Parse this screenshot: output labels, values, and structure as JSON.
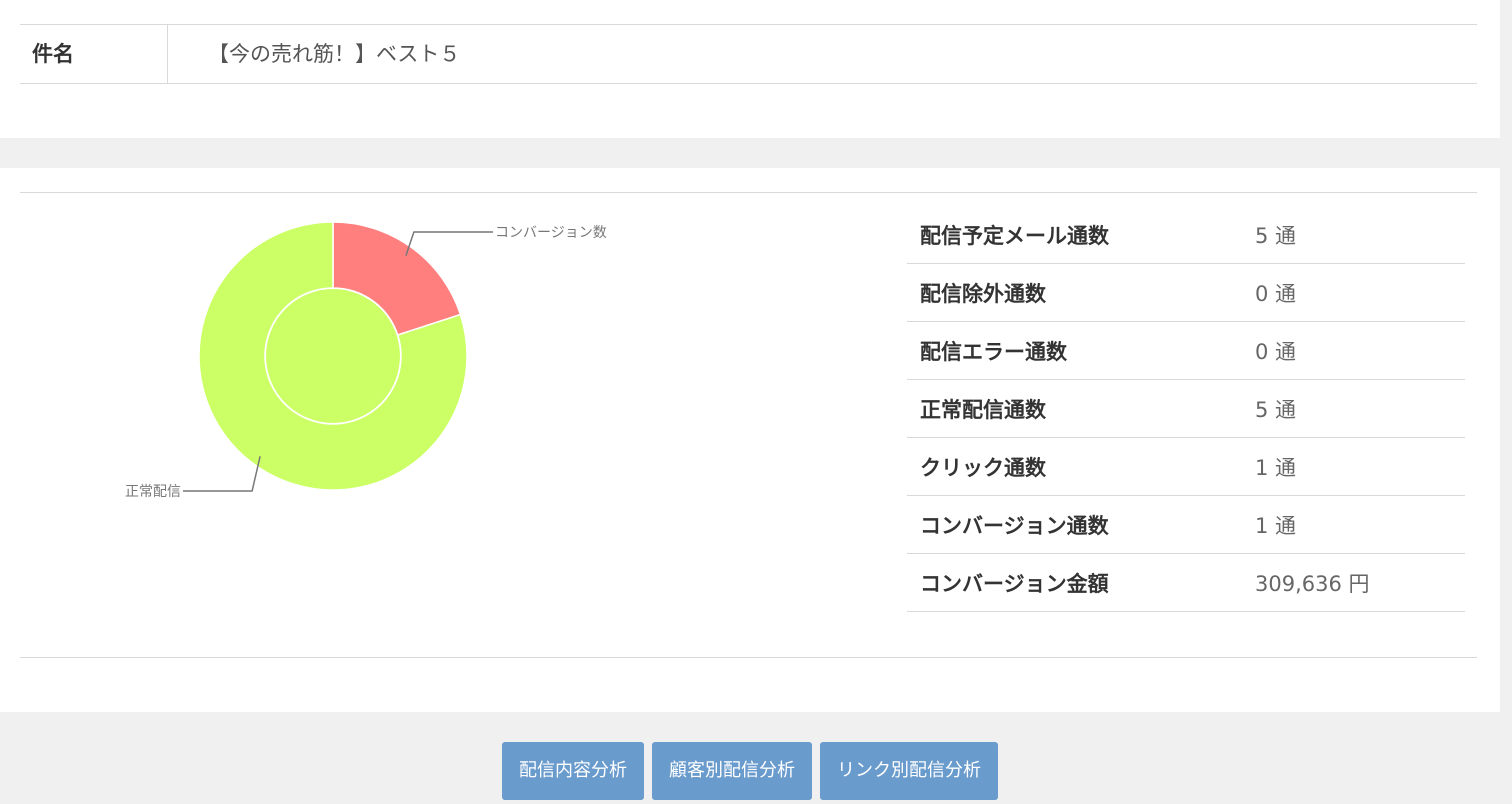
{
  "subject": {
    "label": "件名",
    "value": "【今の売れ筋！】ベスト５"
  },
  "chart_data": {
    "type": "pie",
    "variant": "two-ring-donut",
    "slices": [
      {
        "label": "コンバージョン数",
        "value": 1,
        "color": "#ff7f7f"
      },
      {
        "label": "正常配信",
        "value": 4,
        "color": "#ccff66"
      }
    ],
    "inner_ring": {
      "label": "",
      "color": "#ccff66"
    }
  },
  "stats": [
    {
      "label": "配信予定メール通数",
      "value": "5 通"
    },
    {
      "label": "配信除外通数",
      "value": "0 通"
    },
    {
      "label": "配信エラー通数",
      "value": "0 通"
    },
    {
      "label": "正常配信通数",
      "value": "5 通"
    },
    {
      "label": "クリック通数",
      "value": "1 通"
    },
    {
      "label": "コンバージョン通数",
      "value": "1 通"
    },
    {
      "label": "コンバージョン金額",
      "value": "309,636 円"
    }
  ],
  "buttons": [
    {
      "label": "配信内容分析"
    },
    {
      "label": "顧客別配信分析"
    },
    {
      "label": "リンク別配信分析"
    }
  ]
}
